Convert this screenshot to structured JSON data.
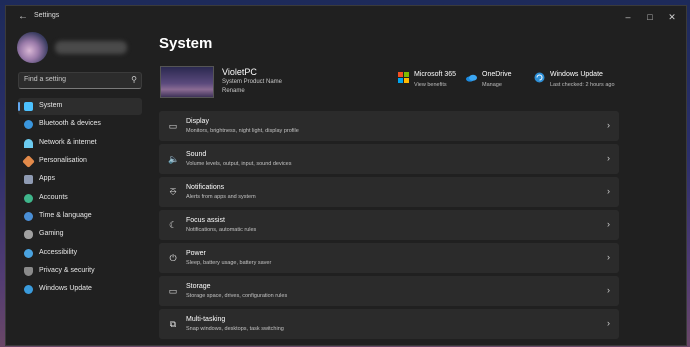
{
  "window": {
    "title": "Settings"
  },
  "search": {
    "placeholder": "Find a setting"
  },
  "sidebar": {
    "items": [
      {
        "label": "System",
        "icon": "system-icon",
        "color": "#4cc2ff",
        "active": true
      },
      {
        "label": "Bluetooth & devices",
        "icon": "bluetooth-icon",
        "color": "#3a96dd"
      },
      {
        "label": "Network & internet",
        "icon": "network-icon",
        "color": "#6ccbf0"
      },
      {
        "label": "Personalisation",
        "icon": "personalisation-icon",
        "color": "#e38a4a"
      },
      {
        "label": "Apps",
        "icon": "apps-icon",
        "color": "#8f9bb3"
      },
      {
        "label": "Accounts",
        "icon": "accounts-icon",
        "color": "#3fb68b"
      },
      {
        "label": "Time & language",
        "icon": "time-language-icon",
        "color": "#4a8fd6"
      },
      {
        "label": "Gaming",
        "icon": "gaming-icon",
        "color": "#a0a0a0"
      },
      {
        "label": "Accessibility",
        "icon": "accessibility-icon",
        "color": "#4aa3e0"
      },
      {
        "label": "Privacy & security",
        "icon": "privacy-icon",
        "color": "#8a8a8a"
      },
      {
        "label": "Windows Update",
        "icon": "windows-update-icon",
        "color": "#3a9bdc"
      }
    ]
  },
  "main": {
    "title": "System",
    "pc": {
      "name": "VioletPC",
      "subtitle": "System Product Name",
      "rename": "Rename"
    },
    "quick": [
      {
        "title": "Microsoft 365",
        "subtitle": "View benefits",
        "icon": "microsoft-365-icon"
      },
      {
        "title": "OneDrive",
        "subtitle": "Manage",
        "icon": "onedrive-icon"
      },
      {
        "title": "Windows Update",
        "subtitle": "Last checked: 2 hours ago",
        "icon": "windows-update-icon"
      }
    ],
    "cards": [
      {
        "title": "Display",
        "subtitle": "Monitors, brightness, night light, display profile",
        "icon": "display-icon"
      },
      {
        "title": "Sound",
        "subtitle": "Volume levels, output, input, sound devices",
        "icon": "sound-icon"
      },
      {
        "title": "Notifications",
        "subtitle": "Alerts from apps and system",
        "icon": "notifications-icon"
      },
      {
        "title": "Focus assist",
        "subtitle": "Notifications, automatic rules",
        "icon": "focus-assist-icon"
      },
      {
        "title": "Power",
        "subtitle": "Sleep, battery usage, battery saver",
        "icon": "power-icon"
      },
      {
        "title": "Storage",
        "subtitle": "Storage space, drives, configuration rules",
        "icon": "storage-icon"
      },
      {
        "title": "Multi-tasking",
        "subtitle": "Snap windows, desktops, task switching",
        "icon": "multitasking-icon"
      }
    ]
  }
}
